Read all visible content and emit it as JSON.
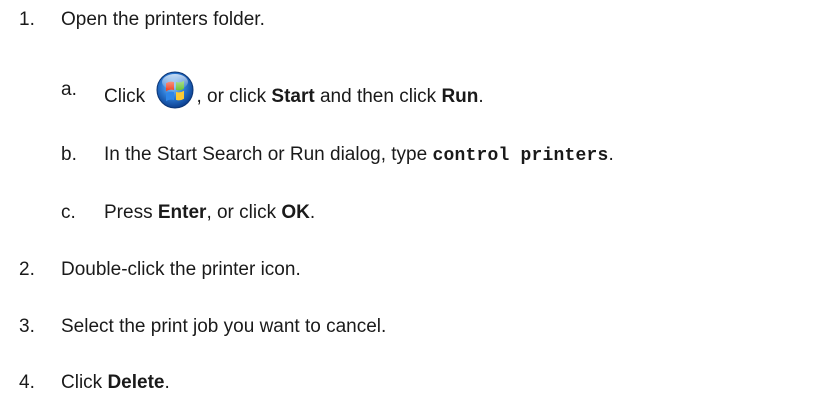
{
  "steps": [
    {
      "number": "1.",
      "text": "Open the printers folder.",
      "substeps": [
        {
          "letter": "a.",
          "pre": "Click ",
          "icon": "windows-start-orb-icon",
          "mid": ", or click ",
          "bold1": "Start",
          "mid2": " and then click ",
          "bold2": "Run",
          "post": "."
        },
        {
          "letter": "b.",
          "pre": "In the Start Search or Run dialog, type ",
          "code": "control printers",
          "post": "."
        },
        {
          "letter": "c.",
          "pre": "Press ",
          "bold1": "Enter",
          "mid": ", or click ",
          "bold2": "OK",
          "post": "."
        }
      ]
    },
    {
      "number": "2.",
      "text": "Double-click the printer icon."
    },
    {
      "number": "3.",
      "text": "Select the print job you want to cancel."
    },
    {
      "number": "4.",
      "pre": "Click ",
      "bold": "Delete",
      "post": "."
    }
  ],
  "colors": {
    "text": "#1a1a1a",
    "orb_blue": "#1d6fd1",
    "orb_red": "#e8402a",
    "orb_green": "#5dbb3c",
    "orb_yellow": "#f7c531"
  }
}
